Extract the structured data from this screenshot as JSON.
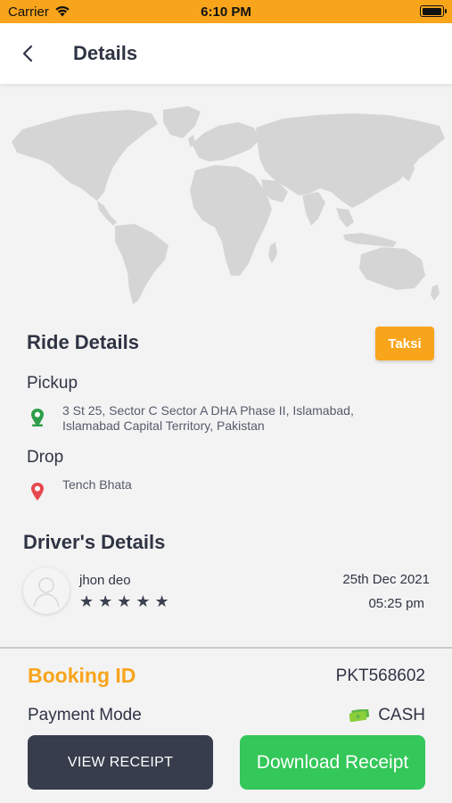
{
  "status_bar": {
    "carrier": "Carrier",
    "time": "6:10 PM"
  },
  "header": {
    "title": "Details",
    "back_icon": "chevron-left-icon"
  },
  "ride": {
    "title": "Ride Details",
    "vehicle_type": "Taksi",
    "pickup_label": "Pickup",
    "pickup_address_line1": "3 St 25, Sector C Sector A DHA Phase II, Islamabad,",
    "pickup_address_line2": "Islamabad Capital Territory, Pakistan",
    "drop_label": "Drop",
    "drop_address": "Tench Bhata"
  },
  "driver": {
    "title": "Driver's Details",
    "name": "jhon deo",
    "rating_stars": "★★★★★",
    "rating": 5,
    "date": "25th Dec 2021",
    "time": "05:25 pm"
  },
  "booking": {
    "id_label": "Booking ID",
    "id_value": "PKT568602",
    "payment_label": "Payment Mode",
    "payment_value": "CASH"
  },
  "actions": {
    "view_receipt": "VIEW RECEIPT",
    "download_receipt": "Download Receipt"
  },
  "colors": {
    "accent": "#f8a51c",
    "green": "#34c759",
    "dark": "#373d4c",
    "pickup_pin": "#2e9e4a",
    "drop_pin": "#e5484d"
  }
}
